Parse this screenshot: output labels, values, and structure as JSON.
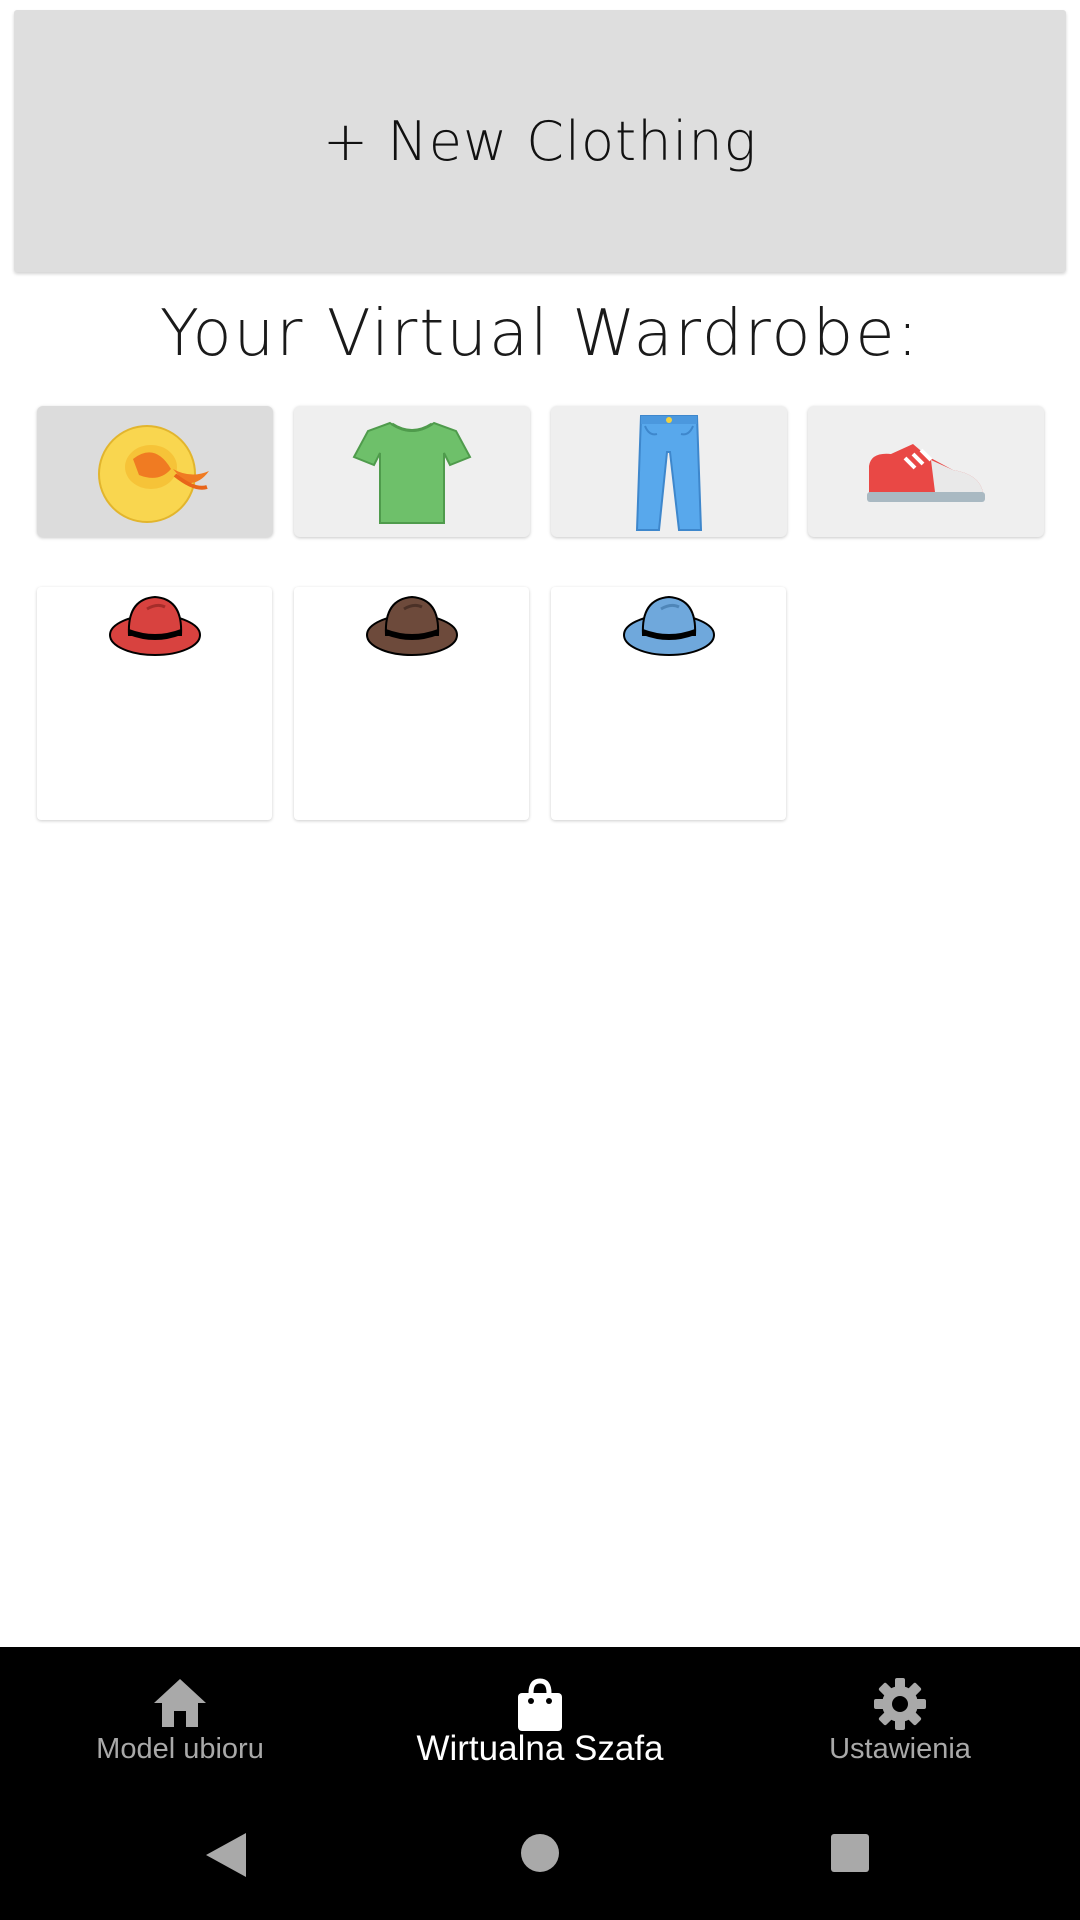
{
  "new_clothing_button": {
    "label": "+ New Clothing"
  },
  "wardrobe": {
    "title": "Your Virtual Wardrobe:",
    "categories": [
      {
        "icon": "sun-hat-icon",
        "selected": true
      },
      {
        "icon": "tshirt-icon",
        "selected": false
      },
      {
        "icon": "jeans-icon",
        "selected": false
      },
      {
        "icon": "sneaker-icon",
        "selected": false
      }
    ],
    "items": [
      {
        "icon": "hat-icon",
        "color": "#d8423f"
      },
      {
        "icon": "hat-icon",
        "color": "#6d4a3b"
      },
      {
        "icon": "hat-icon",
        "color": "#6fa8dc"
      }
    ]
  },
  "bottom_nav": {
    "items": [
      {
        "label": "Model ubioru",
        "icon": "home-icon",
        "active": false
      },
      {
        "label": "Wirtualna Szafa",
        "icon": "shopping-bag-icon",
        "active": true
      },
      {
        "label": "Ustawienia",
        "icon": "gear-icon",
        "active": false
      }
    ]
  },
  "system_nav": {
    "buttons": [
      "back-icon",
      "home-circle-icon",
      "recents-square-icon"
    ]
  },
  "colors": {
    "accent_panel": "#dedede",
    "nav_background": "#000000",
    "nav_active": "#ffffff",
    "nav_inactive": "#a9a9a9"
  }
}
